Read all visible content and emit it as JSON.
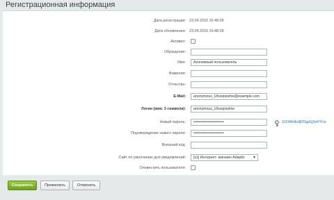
{
  "header": {
    "title": "Регистрационная информация"
  },
  "fields": {
    "reg_date_label": "Дата регистрации:",
    "reg_date_value": "23.04.2016 16:48:28",
    "upd_date_label": "Дата обновления:",
    "upd_date_value": "23.04.2016 16:48:28",
    "active_label": "Активен:",
    "salutation_label": "Обращение:",
    "salutation_value": "",
    "name_label": "Имя:",
    "name_value": "Анонимный пользователь",
    "lastname_label": "Фамилия:",
    "lastname_value": "",
    "patronymic_label": "Отчество:",
    "patronymic_value": "",
    "email_label": "E-Mail:",
    "email_value": "anonymous_Uhuwpwshw@example.com",
    "login_label": "Логин (мин. 3 символа):",
    "login_value": "anonymous_Uhuwpwshw",
    "new_password_label": "Новый пароль:",
    "new_password_mask": "••••••••••••••••••••••••",
    "generated_password": "G334H&v$ZGgbQtvK%!a",
    "confirm_password_label": "Подтверждение нового пароля:",
    "confirm_password_mask": "••••••••••••••••••••••••",
    "external_code_label": "Внешний код:",
    "external_code_value": "",
    "default_site_label": "Сайт по умолчанию для уведомлений:",
    "default_site_value": "[s1] Интернет- магазин Adaptiv",
    "notify_user_label": "Оповестить пользователя:"
  },
  "buttons": {
    "save": "Сохранить",
    "apply": "Применить",
    "cancel": "Отменить"
  },
  "colors": {
    "accent": "#7ab22b",
    "link": "#2a76ae",
    "background": "#e4eaea"
  },
  "icons": {
    "key": "key-icon",
    "dropdown": "chevron-down-icon"
  }
}
